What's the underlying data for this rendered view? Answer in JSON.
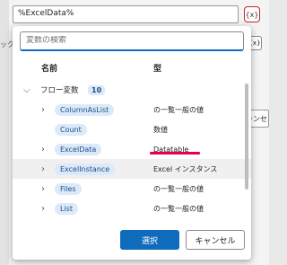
{
  "background": {
    "input_value": "%ExcelData%",
    "fx_label": "{x}",
    "fx2_label": "{x}",
    "fragment_left": "ック",
    "cancel_partial": "ャンセル"
  },
  "popup": {
    "search_placeholder": "変数の検索",
    "col_name": "名前",
    "col_type": "型",
    "group": {
      "label": "フロー変数",
      "count": "10"
    },
    "items": [
      {
        "name": "ColumnAsList",
        "type": "の一覧一般の値"
      },
      {
        "name": "Count",
        "type": "数値"
      },
      {
        "name": "ExcelData",
        "type": "Datatable"
      },
      {
        "name": "ExcelInstance",
        "type": "Excel インスタンス"
      },
      {
        "name": "Files",
        "type": "の一覧一般の値"
      },
      {
        "name": "List",
        "type": "の一覧一般の値"
      }
    ],
    "select_label": "選択",
    "cancel_label": "キャンセル"
  },
  "colors": {
    "accent": "#0f6cbd",
    "highlight": "#e8004f",
    "fx_border": "#c4262e"
  }
}
